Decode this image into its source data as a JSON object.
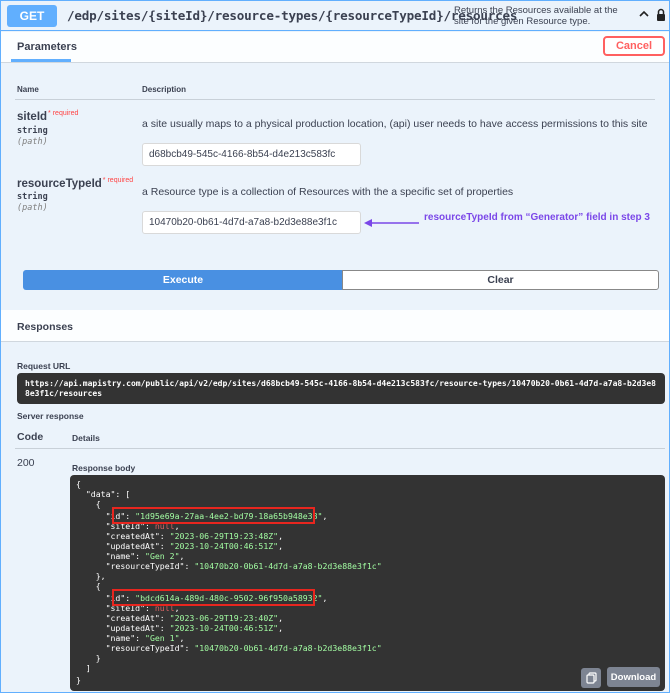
{
  "operation": {
    "method": "GET",
    "path": "/edp/sites/{siteId}/resource-types/{resourceTypeId}/resources",
    "description": "Returns the Resources available at the site for the given Resource type."
  },
  "params_section": {
    "tab_label": "Parameters",
    "cancel_label": "Cancel",
    "col_name": "Name",
    "col_description": "Description"
  },
  "parameters": [
    {
      "name": "siteId",
      "required_mark": "* required",
      "type": "string",
      "location": "(path)",
      "description": "a site usually maps to a physical production location, (api) user needs to have access permissions to this site",
      "value": "d68bcb49-545c-4166-8b54-d4e213c583fc"
    },
    {
      "name": "resourceTypeId",
      "required_mark": "* required",
      "type": "string",
      "location": "(path)",
      "description": "a Resource type is a collection of Resources with the a specific set of properties",
      "value": "10470b20-0b61-4d7d-a7a8-b2d3e88e3f1c"
    }
  ],
  "annotation": {
    "text": "resourceTypeId from “Generator” field in step 3",
    "color": "#7b47e8"
  },
  "actions": {
    "execute_label": "Execute",
    "clear_label": "Clear"
  },
  "responses": {
    "title": "Responses",
    "request_url_label": "Request URL",
    "request_url": "https://api.mapistry.com/public/api/v2/edp/sites/d68bcb49-545c-4166-8b54-d4e213c583fc/resource-types/10470b20-0b61-4d7d-a7a8-b2d3e88e3f1c/resources",
    "server_response_label": "Server response",
    "code_label": "Code",
    "details_label": "Details",
    "status_code": "200",
    "body_label": "Response body",
    "download_label": "Download"
  },
  "response_body": {
    "open": "{",
    "data_key": "\"data\": [",
    "items": [
      {
        "open": "{",
        "id": "\"1d95e69a-27aa-4ee2-bd79-18a65b948e38\"",
        "siteId": "null",
        "createdAt": "\"2023-06-29T19:23:48Z\"",
        "updatedAt": "\"2023-10-24T00:46:51Z\"",
        "name": "\"Gen 2\"",
        "resourceTypeId": "\"10470b20-0b61-4d7d-a7a8-b2d3e88e3f1c\"",
        "close": "},"
      },
      {
        "open": "{",
        "id": "\"bdcd614a-489d-480c-9502-96f950a58932\"",
        "siteId": "null",
        "createdAt": "\"2023-06-29T19:23:40Z\"",
        "updatedAt": "\"2023-10-24T00:46:51Z\"",
        "name": "\"Gen 1\"",
        "resourceTypeId": "\"10470b20-0b61-4d7d-a7a8-b2d3e88e3f1c\"",
        "close": "}"
      }
    ],
    "array_close": "]",
    "close": "}"
  },
  "colors": {
    "get_blue": "#61affe",
    "execute_blue": "#4990e2",
    "cancel_red": "#ff6060",
    "highlight_red": "#e8261f",
    "code_bg": "#333333",
    "string_green": "#a2fca2"
  },
  "icons": [
    "chevron-up-icon",
    "lock-icon",
    "copy-icon",
    "annotation-arrow-icon"
  ]
}
